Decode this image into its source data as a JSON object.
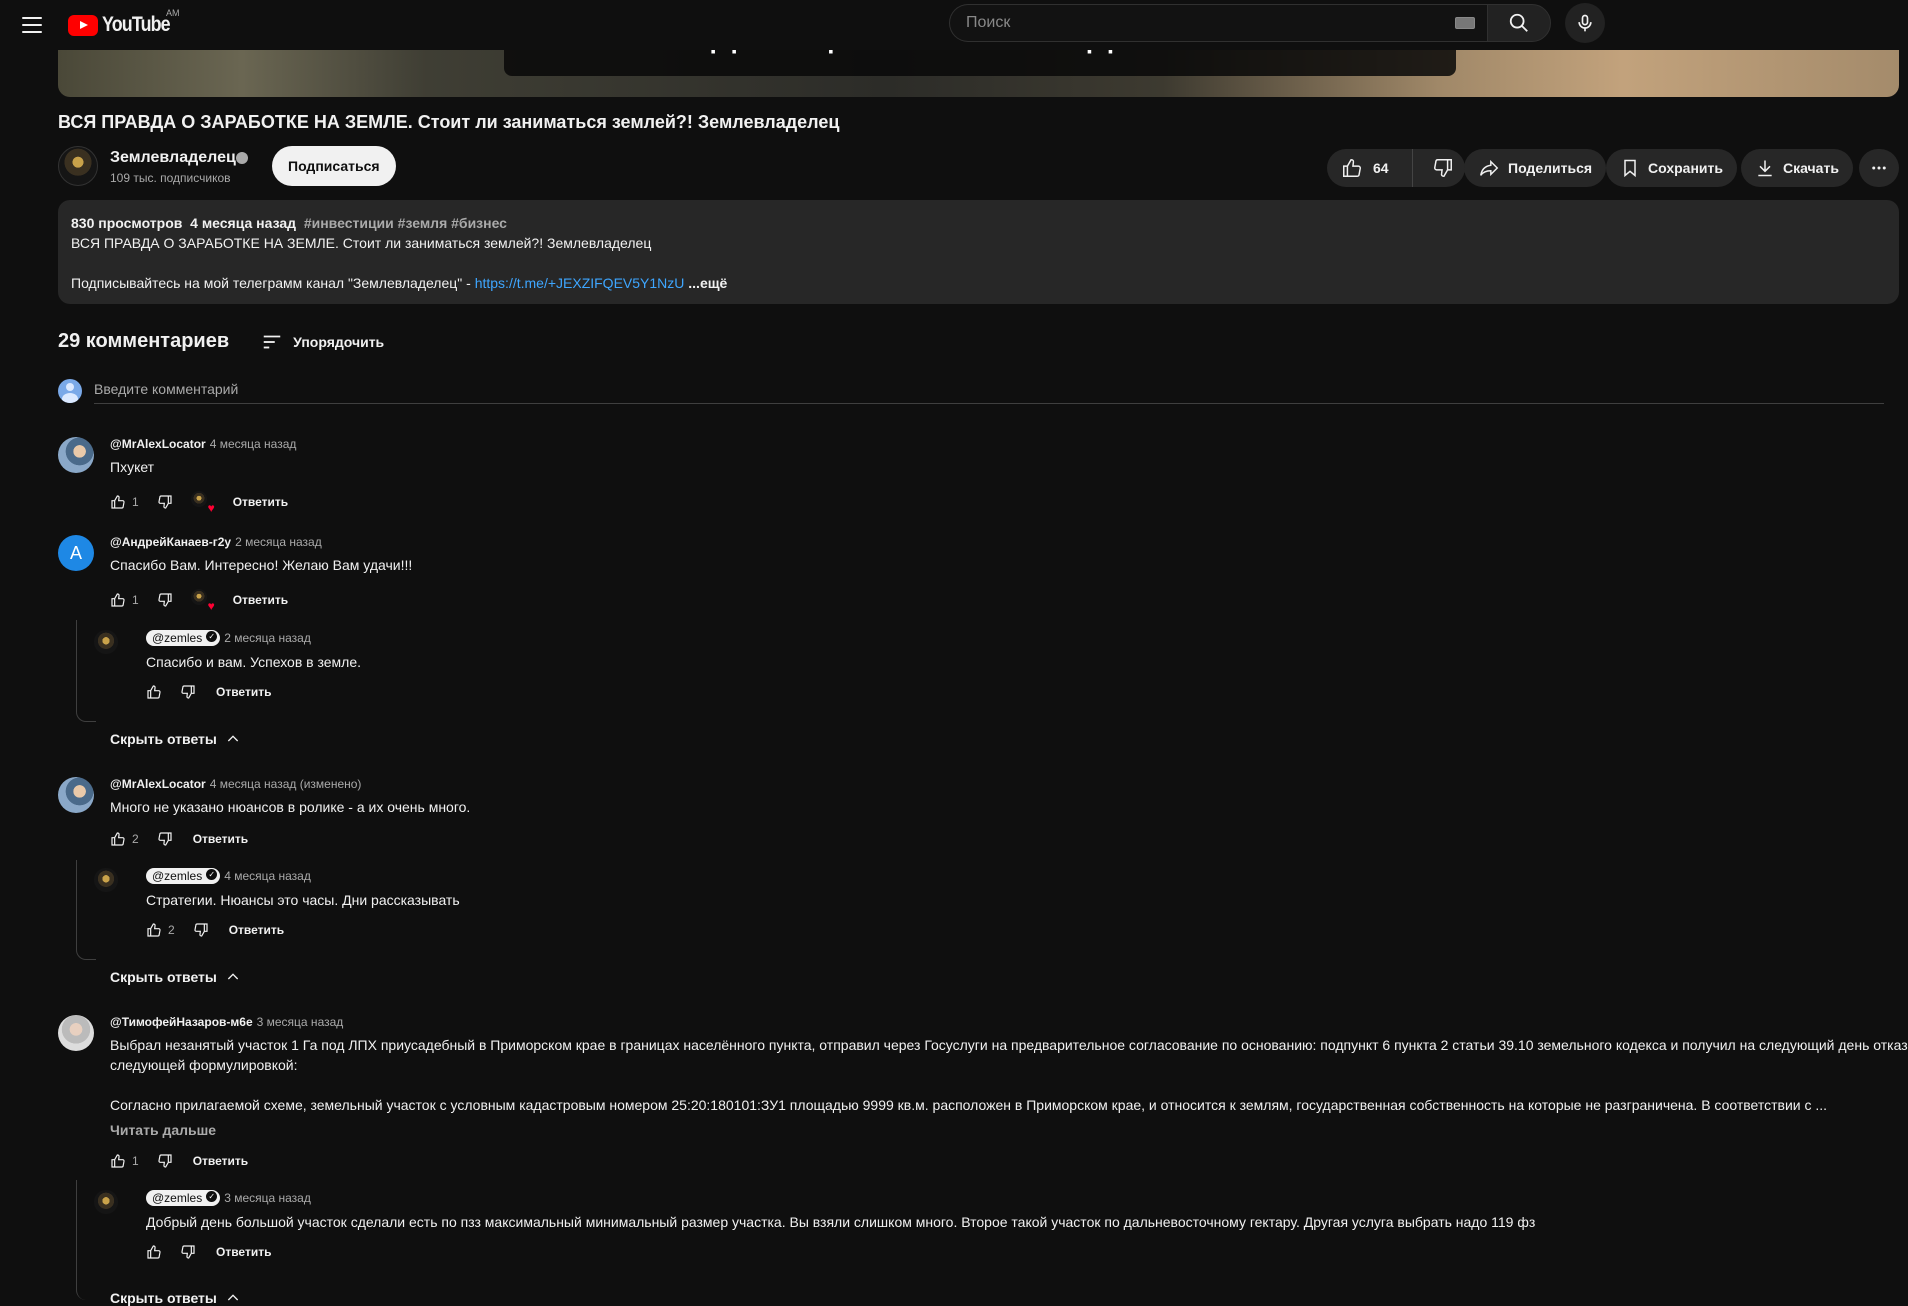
{
  "header": {
    "logo_text": "YouTube",
    "region": "AM",
    "search_placeholder": "Поиск"
  },
  "video": {
    "thumbnail_caption": "землевладельцы. В этом видео я хотел бы",
    "title": "ВСЯ ПРАВДА О ЗАРАБОТКЕ НА ЗЕМЛЕ. Стоит ли заниматься землей?! Землевладелец",
    "channel_name": "Землевладелец",
    "subscribers": "109 тыс. подписчиков",
    "subscribe_label": "Подписаться",
    "likes": "64",
    "share_label": "Поделиться",
    "save_label": "Сохранить",
    "download_label": "Скачать"
  },
  "description": {
    "views": "830 просмотров",
    "date": "4 месяца назад",
    "tags": "#инвестиции #земля #бизнес",
    "line1": "ВСЯ ПРАВДА О ЗАРАБОТКЕ НА ЗЕМЛЕ. Стоит ли заниматься землей?! Землевладелец",
    "line2_text": "Подписывайтесь на мой телеграмм канал \"Землевладелец\" - ",
    "line2_link": "https://t.me/+JEXZIFQEV5Y1NzU",
    "more_label": "...ещё"
  },
  "comments_section": {
    "count_label": "29 комментариев",
    "sort_label": "Упорядочить",
    "add_placeholder": "Введите комментарий",
    "reply_label": "Ответить",
    "hide_replies_label": "Скрыть ответы",
    "read_more_label": "Читать дальше"
  },
  "comments": [
    {
      "author": "@MrAlexLocator",
      "time": "4 месяца назад",
      "text": "Пхукет",
      "likes": "1"
    },
    {
      "author": "@АндрейКанаев-г2у",
      "time": "2 месяца назад",
      "text": "Спасибо Вам. Интересно! Желаю Вам удачи!!!",
      "likes": "1",
      "avatar_letter": "А",
      "reply": {
        "author": "@zemles",
        "time": "2 месяца назад",
        "text": "Спасибо и вам. Успехов в земле.",
        "likes": ""
      }
    },
    {
      "author": "@MrAlexLocator",
      "time": "4 месяца назад (изменено)",
      "text": "Много не указано нюансов в ролике -  а их очень много.",
      "likes": "2",
      "reply": {
        "author": "@zemles",
        "time": "4 месяца назад",
        "text": "Стратегии. Нюансы это часы. Дни рассказывать",
        "likes": "2"
      }
    },
    {
      "author": "@ТимофейНазаров-м6е",
      "time": "3 месяца назад",
      "text": "Выбрал незанятый участок 1 Га под ЛПХ приусадебный в Приморском крае в границах населённого пункта, отправил через Госуслуги на предварительное согласование по основанию: подпункт 6 пункта 2 статьи 39.10 земельного кодекса и получил на следующий день отказ со следующей формулировкой:",
      "text2": "Согласно прилагаемой схеме, земельный участок с условным кадастровым номером 25:20:180101:ЗУ1 площадью 9999 кв.м. расположен в Приморском крае, и относится к землям, государственная собственность на которые не разграничена. В соответствии с ...",
      "likes": "1",
      "reply": {
        "author": "@zemles",
        "time": "3 месяца назад",
        "text": "Добрый день большой участок сделали есть по пзз максимальный минимальный размер участка. Вы взяли слишком много. Второе такой участок по дальневосточному гектару. Другая услуга выбрать надо 119 фз",
        "likes": ""
      }
    }
  ],
  "colors": {
    "background": "#0f0f0f",
    "pill": "#272727",
    "link": "#3ea6ff",
    "brand_red": "#ff0000"
  }
}
